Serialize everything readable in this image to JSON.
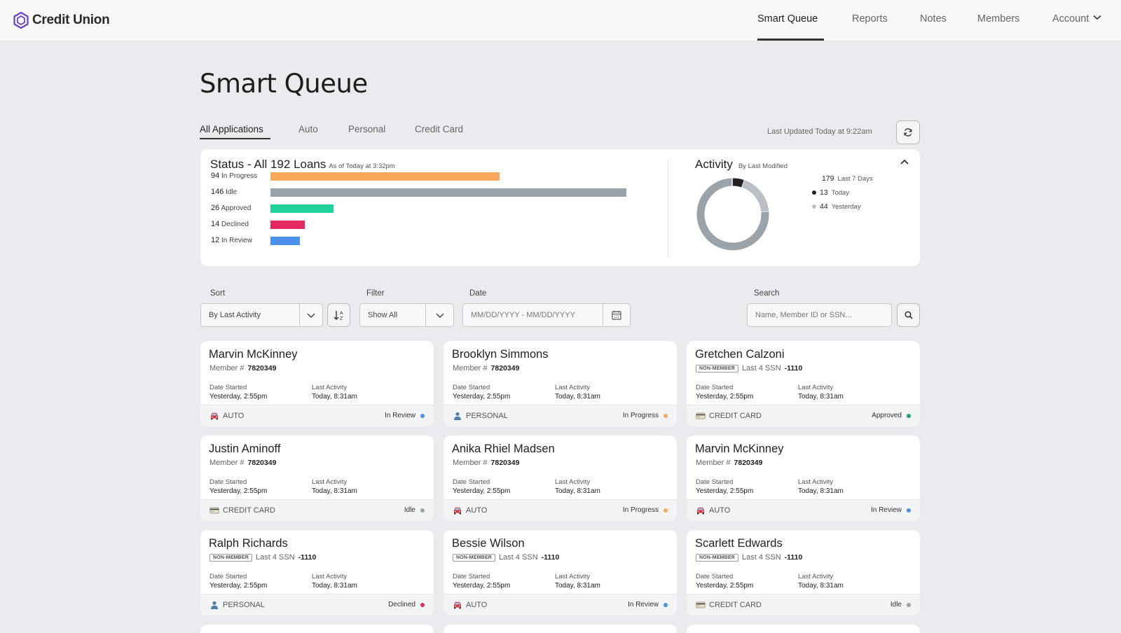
{
  "brand": {
    "name": "Credit Union",
    "color": "#6a3fd1"
  },
  "nav": {
    "items": [
      {
        "label": "Smart Queue",
        "active": true
      },
      {
        "label": "Reports",
        "active": false
      },
      {
        "label": "Notes",
        "active": false
      },
      {
        "label": "Members",
        "active": false
      },
      {
        "label": "Account",
        "active": false,
        "icon": "chevron-down-icon"
      }
    ]
  },
  "page": {
    "title": "Smart Queue"
  },
  "tabs": [
    {
      "label": "All Applications",
      "active": true
    },
    {
      "label": "Auto",
      "active": false
    },
    {
      "label": "Personal",
      "active": false
    },
    {
      "label": "Credit Card",
      "active": false
    }
  ],
  "last_updated": "Last Updated Today at 9:22am",
  "status": {
    "title": "Status - All 192 Loans",
    "subtitle": "As of Today at 3:32pm",
    "bars": [
      {
        "count": "94",
        "label": "In Progress",
        "value": 94,
        "color": "#f8a95b"
      },
      {
        "count": "146",
        "label": "Idle",
        "value": 146,
        "color": "#9aa3aa"
      },
      {
        "count": "26",
        "label": "Approved",
        "value": 26,
        "color": "#1ed39a"
      },
      {
        "count": "14",
        "label": "Declined",
        "value": 14,
        "color": "#e3295f"
      },
      {
        "count": "12",
        "label": "In Review",
        "value": 12,
        "color": "#4a90ec"
      }
    ]
  },
  "activity": {
    "title": "Activity",
    "subtitle": "By Last Modified",
    "legend": [
      {
        "count": "179",
        "label": "Last 7 Days",
        "value": 179,
        "color": "#9aa3aa"
      },
      {
        "count": "13",
        "label": "Today",
        "value": 13,
        "color": "#222222"
      },
      {
        "count": "44",
        "label": "Yesterday",
        "value": 44,
        "color": "#b9bfc4"
      }
    ]
  },
  "filters": {
    "sort": {
      "label": "Sort",
      "value": "By Last Activity"
    },
    "filter": {
      "label": "Filter",
      "value": "Show All"
    },
    "date": {
      "label": "Date",
      "placeholder": "MM/DD/YYYY - MM/DD/YYYY"
    },
    "search": {
      "label": "Search",
      "placeholder": "Name, Member ID or SSN..."
    }
  },
  "card_labels": {
    "date_started": "Date Started",
    "last_activity": "Last Activity",
    "member": "Member #",
    "ssn": "Last 4 SSN",
    "non_member": "NON-MEMBER"
  },
  "cards": [
    {
      "name": "Marvin McKinney",
      "member": true,
      "id": "7820349",
      "date_started": "Yesterday, 2:55pm",
      "last_activity": "Today, 8:31am",
      "type": "AUTO",
      "status": "In Review",
      "status_color": "#4a90ec"
    },
    {
      "name": "Brooklyn Simmons",
      "member": true,
      "id": "7820349",
      "date_started": "Yesterday, 2:55pm",
      "last_activity": "Today, 8:31am",
      "type": "PERSONAL",
      "status": "In Progress",
      "status_color": "#f8a95b"
    },
    {
      "name": "Gretchen Calzoni",
      "member": false,
      "id": "-1110",
      "date_started": "Yesterday, 2:55pm",
      "last_activity": "Today, 8:31am",
      "type": "CREDIT CARD",
      "status": "Approved",
      "status_color": "#1ea86d"
    },
    {
      "name": "Justin Aminoff",
      "member": true,
      "id": "7820349",
      "date_started": "Yesterday, 2:55pm",
      "last_activity": "Today, 8:31am",
      "type": "CREDIT CARD",
      "status": "Idle",
      "status_color": "#9aa3aa"
    },
    {
      "name": "Anika Rhiel Madsen",
      "member": true,
      "id": "7820349",
      "date_started": "Yesterday, 2:55pm",
      "last_activity": "Today, 8:31am",
      "type": "AUTO",
      "status": "In Progress",
      "status_color": "#f8a95b"
    },
    {
      "name": "Marvin McKinney",
      "member": true,
      "id": "7820349",
      "date_started": "Yesterday, 2:55pm",
      "last_activity": "Today, 8:31am",
      "type": "AUTO",
      "status": "In Review",
      "status_color": "#4a90ec"
    },
    {
      "name": "Ralph Richards",
      "member": false,
      "id": "-1110",
      "date_started": "Yesterday, 2:55pm",
      "last_activity": "Today, 8:31am",
      "type": "PERSONAL",
      "status": "Declined",
      "status_color": "#e3295f"
    },
    {
      "name": "Bessie Wilson",
      "member": false,
      "id": "-1110",
      "date_started": "Yesterday, 2:55pm",
      "last_activity": "Today, 8:31am",
      "type": "AUTO",
      "status": "In Review",
      "status_color": "#4a90ec"
    },
    {
      "name": "Scarlett Edwards",
      "member": false,
      "id": "-1110",
      "date_started": "Yesterday, 2:55pm",
      "last_activity": "Today, 8:31am",
      "type": "CREDIT CARD",
      "status": "Idle",
      "status_color": "#9aa3aa"
    }
  ]
}
